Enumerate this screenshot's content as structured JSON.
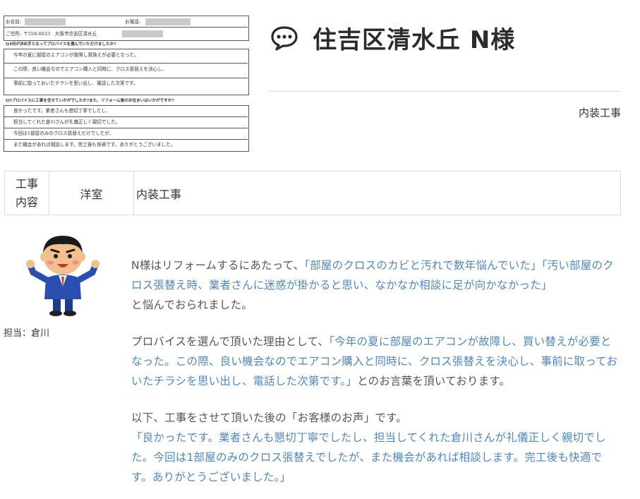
{
  "header": {
    "title": "住吉区清水丘 N様",
    "category": "内装工事"
  },
  "scan": {
    "name_label": "お名前:",
    "phone_label": "お電話:",
    "address_label": "ご住所:",
    "address": "〒558-0033　大阪市住吉区清水丘",
    "q1": "Q4何が決め手となってプロバイスを選んでいただけましたか?",
    "q1_lines": [
      "今年の夏に部屋のエアコンが故障し買換えが必要となった。",
      "この際、良い機会なのでエアコン購入と同時に、クロス張替えを決心し、",
      "事前に取っておいたチラシを思い出し、電話した次第です。"
    ],
    "q2": "Q5プロバイスに工事を任せていかがでしたか?また、リフォーム後のお住まいはいかがですか?",
    "q2_lines": [
      "良かったです。業者さんも懇切丁寧でしたし、",
      "担当してくれた倉川さんが礼儀正しく親切でした。",
      "今回は1部屋のみのクロス張替えだけでしたが、",
      "また機会があれば相談します。完工後も快適です。ありがとうございました。"
    ]
  },
  "info_table": {
    "header": "工事内容",
    "room": "洋室",
    "description": "内装工事"
  },
  "staff": {
    "label": "担当：倉川"
  },
  "body": {
    "p1_prefix": "N様はリフォームするにあたって、",
    "p1_quote": "「部屋のクロスのカビと汚れで数年悩んでいた」「汚い部屋のクロス張替え時、業者さんに迷惑が掛かると思い、なかなか相談に足が向かなかった」",
    "p1_suffix": "と悩んでおられました。",
    "p2_prefix": "プロバイスを選んで頂いた理由として、",
    "p2_quote": "「今年の夏に部屋のエアコンが故障し、買い替えが必要となった。この際、良い機会なのでエアコン購入と同時に、クロス張替えを決心し、事前に取っておいたチラシを思い出し、電話した次第です。」",
    "p2_suffix": "とのお言葉を頂いております。",
    "p3_intro": "以下、工事をさせて頂いた後の「お客様のお声」です。",
    "p3_quote": "「良かったです。業者さんも懇切丁寧でしたし、担当してくれた倉川さんが礼儀正しく親切でした。今回は1部屋のみのクロス張替えでしたが、また機会があれば相談します。完工後も快適です。ありがとうございました。」"
  },
  "colors": {
    "quote": "#4f86bf",
    "text": "#555555",
    "title": "#2b2b2b"
  },
  "icons": {
    "title_icon": "chat-bubble-icon"
  }
}
